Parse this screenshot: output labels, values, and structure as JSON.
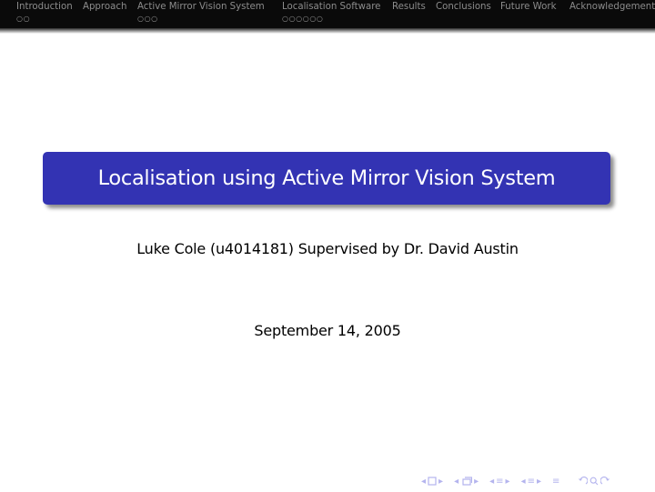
{
  "header": {
    "sections": [
      {
        "label": "Introduction",
        "dots": "○○"
      },
      {
        "label": "Approach",
        "dots": ""
      },
      {
        "label": "Active Mirror Vision System",
        "dots": "○○○"
      },
      {
        "label": "Localisation Software",
        "dots": "○○○○○○"
      },
      {
        "label": "Results",
        "dots": ""
      },
      {
        "label": "Conclusions",
        "dots": ""
      },
      {
        "label": "Future Work",
        "dots": ""
      },
      {
        "label": "Acknowledgements",
        "dots": ""
      }
    ]
  },
  "slide": {
    "title": "Localisation using Active Mirror Vision System",
    "author": "Luke Cole (u4014181) Supervised by Dr.  David Austin",
    "date": "September 14, 2005"
  },
  "colors": {
    "title_box": "#3333b3",
    "header_bg": "#0a0a0a",
    "nav_symbols": "#b4b4ee"
  },
  "nav_symbols": {
    "left_arrow": "◂",
    "right_arrow": "▸",
    "menu": "≡",
    "search": "⌕"
  }
}
